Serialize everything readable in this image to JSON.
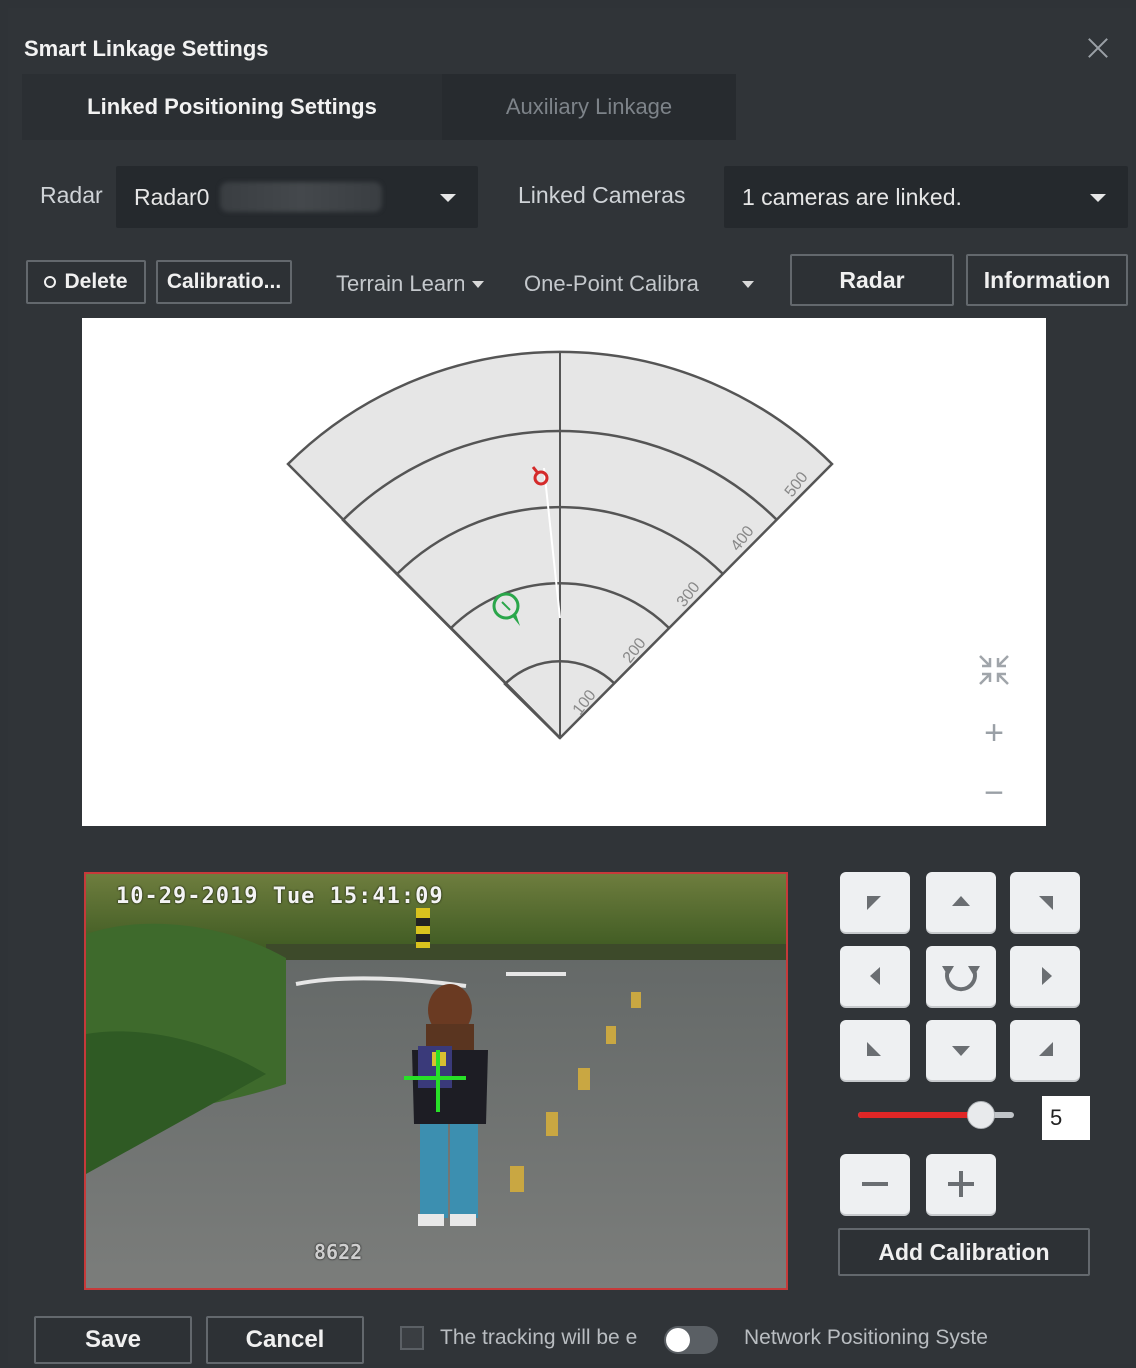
{
  "dialog": {
    "title": "Smart Linkage Settings",
    "tabs": [
      {
        "label": "Linked Positioning Settings",
        "active": true
      },
      {
        "label": "Auxiliary Linkage",
        "active": false
      }
    ]
  },
  "radar_row": {
    "radar_label": "Radar",
    "radar_value": "Radar0",
    "linked_label": "Linked Cameras",
    "linked_value": "1 cameras are linked."
  },
  "toolbar": {
    "delete_label": "Delete",
    "calibration_label": "Calibratio...",
    "terrain_label": "Terrain Learn",
    "one_point_label": "One-Point Calibra",
    "radar_label": "Radar",
    "information_label": "Information"
  },
  "radar_map": {
    "range_labels": [
      "100",
      "200",
      "300",
      "400",
      "500"
    ],
    "colors": {
      "target_red": "#d42a2a",
      "target_green": "#2aa64a",
      "fan_fill": "#e6e6e6"
    }
  },
  "video": {
    "osd_timestamp": "10-29-2019 Tue 15:41:09",
    "osd_channel": "8622"
  },
  "ptz": {
    "speed_value": "5",
    "speed_fraction": 0.78,
    "add_calibration_label": "Add Calibration"
  },
  "footer": {
    "save_label": "Save",
    "cancel_label": "Cancel",
    "tracking_text": "The tracking will be e",
    "network_text": "Network Positioning Syste"
  },
  "colors": {
    "background": "#303438",
    "accent_red": "#e02626",
    "panel_dark": "#25292d"
  }
}
